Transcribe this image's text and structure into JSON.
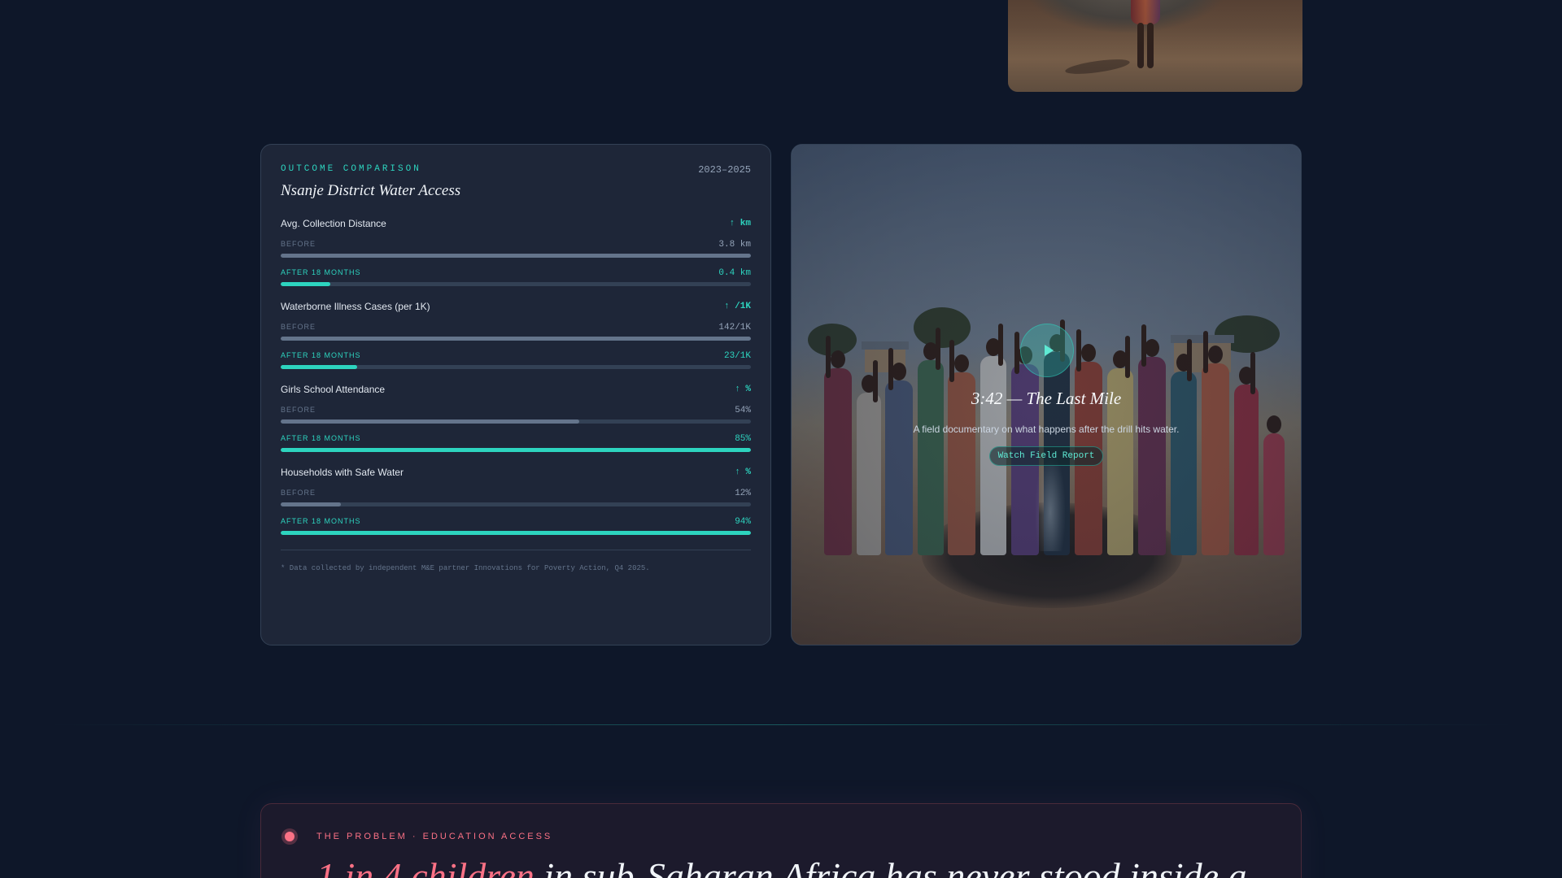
{
  "comparison": {
    "kicker": "OUTCOME COMPARISON",
    "date_range": "2023–2025",
    "title": "Nsanje District Water Access",
    "before_label": "BEFORE",
    "after_label": "AFTER 18 MONTHS",
    "metrics": [
      {
        "label": "Avg. Collection Distance",
        "unit": "↑ km",
        "before": "3.8 km",
        "after": "0.4 km",
        "before_pct": 100,
        "after_pct": 10.5
      },
      {
        "label": "Waterborne Illness Cases (per 1K)",
        "unit": "↑ /1K",
        "before": "142/1K",
        "after": "23/1K",
        "before_pct": 100,
        "after_pct": 16.2
      },
      {
        "label": "Girls School Attendance",
        "unit": "↑ %",
        "before": "54%",
        "after": "85%",
        "before_pct": 63.5,
        "after_pct": 100
      },
      {
        "label": "Households with Safe Water",
        "unit": "↑ %",
        "before": "12%",
        "after": "94%",
        "before_pct": 12.8,
        "after_pct": 100
      }
    ],
    "footnote": "* Data collected by independent M&E partner Innovations for Poverty Action, Q4 2025."
  },
  "video": {
    "title": "3:42 — The Last Mile",
    "description": "A field documentary on what happens after the drill hits water.",
    "button_label": "Watch Field Report",
    "icon": "play-icon"
  },
  "problem": {
    "kicker": "THE PROBLEM · EDUCATION ACCESS",
    "headline_highlight": "1 in 4 children",
    "headline_rest": " in sub-Saharan Africa has never stood inside a"
  },
  "colors": {
    "accent": "#2dd4bf",
    "alert": "#fb7185",
    "background": "#0e1729",
    "card": "#1e2638"
  }
}
